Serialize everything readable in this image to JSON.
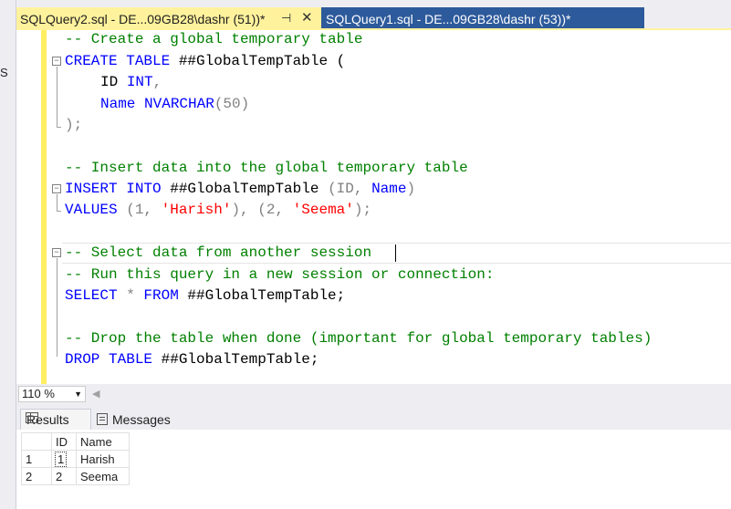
{
  "tabs": [
    {
      "label": "SQLQuery2.sql - DE...09GB28\\dashr (51))*",
      "active": true
    },
    {
      "label": "SQLQuery1.sql - DE...09GB28\\dashr (53))*",
      "active": false
    }
  ],
  "left_strip_fragment": "S",
  "editor": {
    "lines": {
      "l1": "-- Create a global temporary table",
      "l2_kw": "CREATE TABLE",
      "l2_rest": " ##GlobalTempTable (",
      "l3_name": "ID",
      "l3_type": "INT",
      "l3_punc": ",",
      "l4_name": "Name",
      "l4_type": "NVARCHAR",
      "l4_args": "(50)",
      "l5": ");",
      "l7": "-- Insert data into the global temporary table",
      "l8_kw": "INSERT INTO",
      "l8_table": " ##GlobalTempTable ",
      "l8_cols_open": "(ID, ",
      "l8_col2": "Name",
      "l8_cols_close": ")",
      "l9_kw": "VALUES",
      "l9_a": " (1, ",
      "l9_s1": "'Harish'",
      "l9_b": "), (2, ",
      "l9_s2": "'Seema'",
      "l9_c": ");",
      "l11": "-- Select data from another session",
      "l12": "-- Run this query in a new session or connection:",
      "l13_kw": "SELECT",
      "l13_star": " * ",
      "l13_kw2": "FROM",
      "l13_rest": " ##GlobalTempTable;",
      "l15": "-- Drop the table when done (important for global temporary tables)",
      "l16_kw": "DROP TABLE",
      "l16_rest": " ##GlobalTempTable;"
    }
  },
  "zoom": "110 %",
  "result_tabs": {
    "results": "Results",
    "messages": "Messages"
  },
  "grid": {
    "columns": [
      "ID",
      "Name"
    ],
    "rows": [
      {
        "row": "1",
        "id": "1",
        "name": "Harish"
      },
      {
        "row": "2",
        "id": "2",
        "name": "Seema"
      }
    ]
  }
}
